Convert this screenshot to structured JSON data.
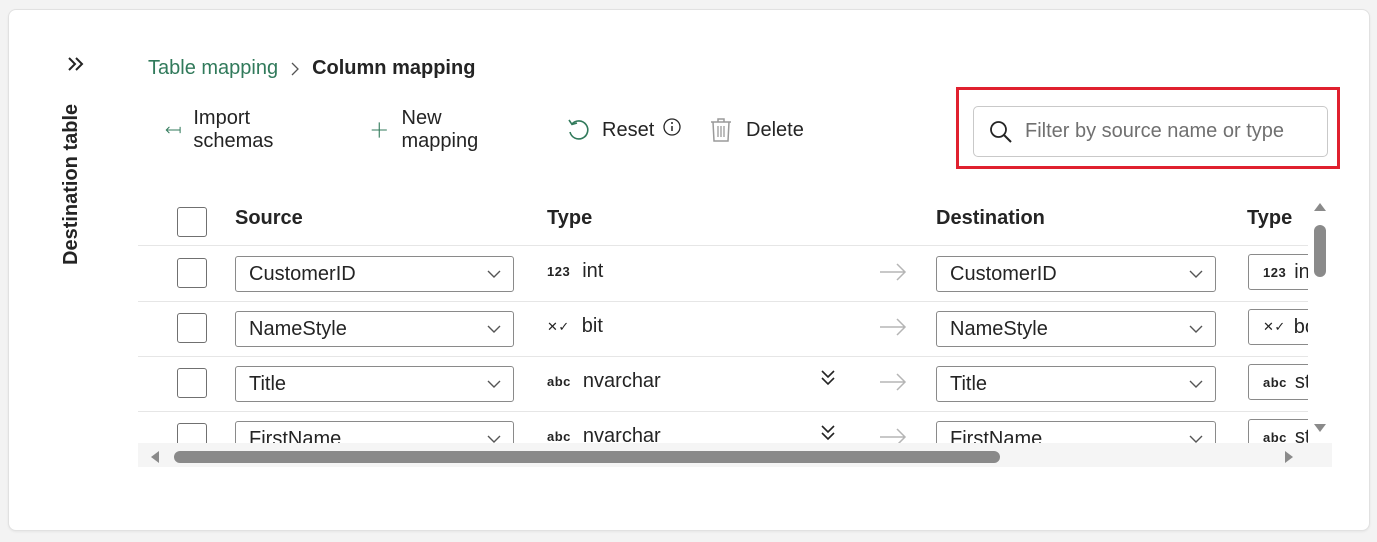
{
  "side_panel": {
    "title": "Destination table",
    "expand_icon": "double-chevron-right-icon"
  },
  "breadcrumb": {
    "parent": "Table mapping",
    "current": "Column mapping"
  },
  "toolbar": {
    "import_label": "Import schemas",
    "new_mapping_label": "New mapping",
    "reset_label": "Reset",
    "delete_label": "Delete"
  },
  "search": {
    "placeholder": "Filter by source name or type",
    "value": ""
  },
  "grid": {
    "headers": {
      "source": "Source",
      "type": "Type",
      "destination": "Destination",
      "dest_type": "Type"
    },
    "rows": [
      {
        "source": "CustomerID",
        "type_glyph": "123",
        "type": "int",
        "expandable": false,
        "destination": "CustomerID",
        "dest_glyph": "123",
        "dest_type": "in"
      },
      {
        "source": "NameStyle",
        "type_glyph": "✕✓",
        "type": "bit",
        "expandable": false,
        "destination": "NameStyle",
        "dest_glyph": "✕✓",
        "dest_type": "bo"
      },
      {
        "source": "Title",
        "type_glyph": "abc",
        "type": "nvarchar",
        "expandable": true,
        "destination": "Title",
        "dest_glyph": "abc",
        "dest_type": "st"
      },
      {
        "source": "FirstName",
        "type_glyph": "abc",
        "type": "nvarchar",
        "expandable": true,
        "destination": "FirstName",
        "dest_glyph": "abc",
        "dest_type": "st"
      }
    ]
  },
  "colors": {
    "accent": "#317a5b",
    "highlight": "#e0202e",
    "text": "#242424"
  }
}
